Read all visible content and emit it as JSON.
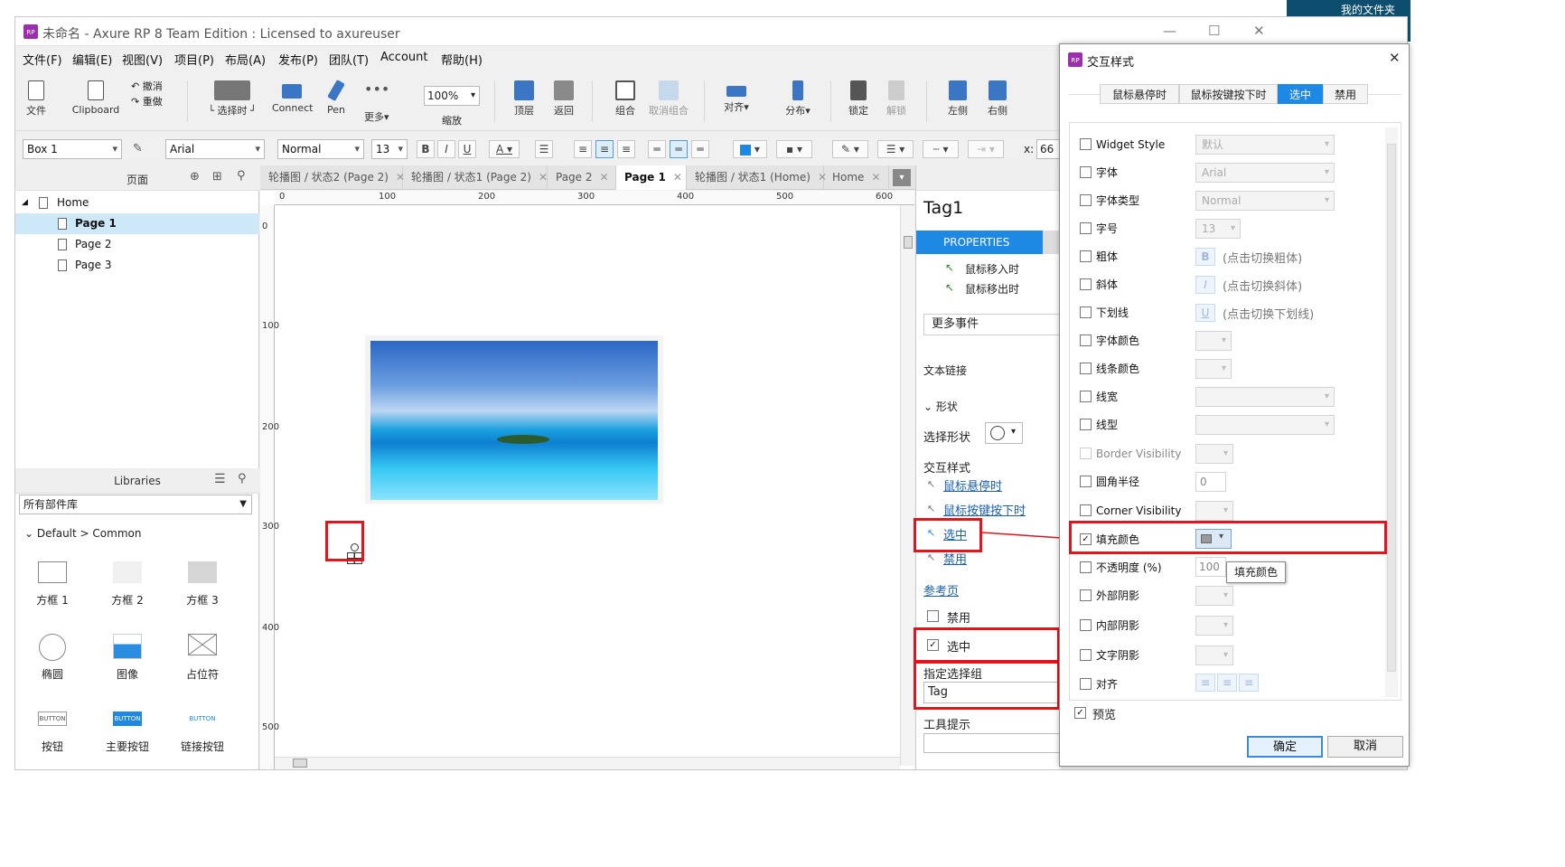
{
  "window": {
    "title": "未命名 - Axure RP 8 Team Edition : Licensed to axureuser"
  },
  "desktop": {
    "folder_label": "我的文件夹"
  },
  "menu": [
    "文件(F)",
    "编辑(E)",
    "视图(V)",
    "项目(P)",
    "布局(A)",
    "发布(P)",
    "团队(T)",
    "Account",
    "帮助(H)"
  ],
  "toolbar": {
    "file": "文件",
    "clipboard": "Clipboard",
    "undo": "撤消",
    "redo": "重做",
    "select_mode": "└ 选择时 ┘",
    "connect": "Connect",
    "pen": "Pen",
    "more": "更多▾",
    "zoom_value": "100%",
    "zoom_label": "缩放",
    "top": "顶层",
    "back": "返回",
    "group": "组合",
    "ungroup": "取消组合",
    "align": "对齐▾",
    "distribute": "分布▾",
    "lock": "锁定",
    "unlock": "解锁",
    "left": "左侧",
    "right": "右侧"
  },
  "format": {
    "widget": "Box 1",
    "font": "Arial",
    "style": "Normal",
    "size": "13",
    "x_label": "x:",
    "x_value": "66"
  },
  "pages_panel": {
    "title": "页面",
    "items": [
      "Home",
      "Page 1",
      "Page 2",
      "Page 3"
    ]
  },
  "libraries": {
    "title": "Libraries",
    "selector": "所有部件库",
    "group": "Default > Common",
    "items": [
      "方框 1",
      "方框 2",
      "方框 3",
      "椭圆",
      "图像",
      "占位符",
      "按钮",
      "主要按钮",
      "链接按钮"
    ],
    "button_text": "BUTTON"
  },
  "tabs": [
    {
      "label": "轮播图 / 状态2 (Page 2)",
      "active": false
    },
    {
      "label": "轮播图 / 状态1 (Page 2)",
      "active": false
    },
    {
      "label": "Page 2",
      "active": false
    },
    {
      "label": "Page 1",
      "active": true
    },
    {
      "label": "轮播图 / 状态1 (Home)",
      "active": false
    },
    {
      "label": "Home",
      "active": false
    }
  ],
  "rulers": {
    "top": [
      "0",
      "100",
      "200",
      "300",
      "400",
      "500",
      "600"
    ],
    "left": [
      "0",
      "100",
      "200",
      "300",
      "400",
      "500"
    ]
  },
  "properties": {
    "widget_name": "Tag1",
    "tab": "PROPERTIES",
    "events": [
      "鼠标移入时",
      "鼠标移出时"
    ],
    "more_events": "更多事件",
    "text_link": "文本链接",
    "shape_section": "形状",
    "select_shape": "选择形状",
    "interaction_styles": "交互样式",
    "style_links": [
      "鼠标悬停时",
      "鼠标按键按下时",
      "选中",
      "禁用"
    ],
    "reference_page": "参考页",
    "disabled": "禁用",
    "selected": "选中",
    "selection_group": "指定选择组",
    "selection_group_value": "Tag",
    "tooltip": "工具提示"
  },
  "dialog": {
    "title": "交互样式",
    "close": "✕",
    "tabs": [
      {
        "label": "鼠标悬停时",
        "active": false
      },
      {
        "label": "鼠标按键按下时",
        "active": false
      },
      {
        "label": "选中",
        "active": true
      },
      {
        "label": "禁用",
        "active": false
      }
    ],
    "rows": [
      {
        "label": "Widget Style",
        "checked": false,
        "value": "默认"
      },
      {
        "label": "字体",
        "checked": false,
        "value": "Arial"
      },
      {
        "label": "字体类型",
        "checked": false,
        "value": "Normal"
      },
      {
        "label": "字号",
        "checked": false,
        "value": "13"
      },
      {
        "label": "粗体",
        "checked": false,
        "value": "(点击切换粗体)"
      },
      {
        "label": "斜体",
        "checked": false,
        "value": "(点击切换斜体)"
      },
      {
        "label": "下划线",
        "checked": false,
        "value": "(点击切换下划线)"
      },
      {
        "label": "字体颜色",
        "checked": false,
        "value": ""
      },
      {
        "label": "线条颜色",
        "checked": false,
        "value": ""
      },
      {
        "label": "线宽",
        "checked": false,
        "value": ""
      },
      {
        "label": "线型",
        "checked": false,
        "value": ""
      },
      {
        "label": "Border Visibility",
        "checked": false,
        "value": ""
      },
      {
        "label": "圆角半径",
        "checked": false,
        "value": "0"
      },
      {
        "label": "Corner Visibility",
        "checked": false,
        "value": ""
      },
      {
        "label": "填充颜色",
        "checked": true,
        "value": ""
      },
      {
        "label": "不透明度 (%)",
        "checked": false,
        "value": "100"
      },
      {
        "label": "外部阴影",
        "checked": false,
        "value": ""
      },
      {
        "label": "内部阴影",
        "checked": false,
        "value": ""
      },
      {
        "label": "文字阴影",
        "checked": false,
        "value": ""
      },
      {
        "label": "对齐",
        "checked": false,
        "value": ""
      }
    ],
    "tooltip": "填充颜色",
    "preview": "预览",
    "ok": "确定",
    "cancel": "取消"
  },
  "colors": {
    "accent": "#1e88e5",
    "highlight": "#e2141c",
    "brand": "#9b2fae"
  }
}
